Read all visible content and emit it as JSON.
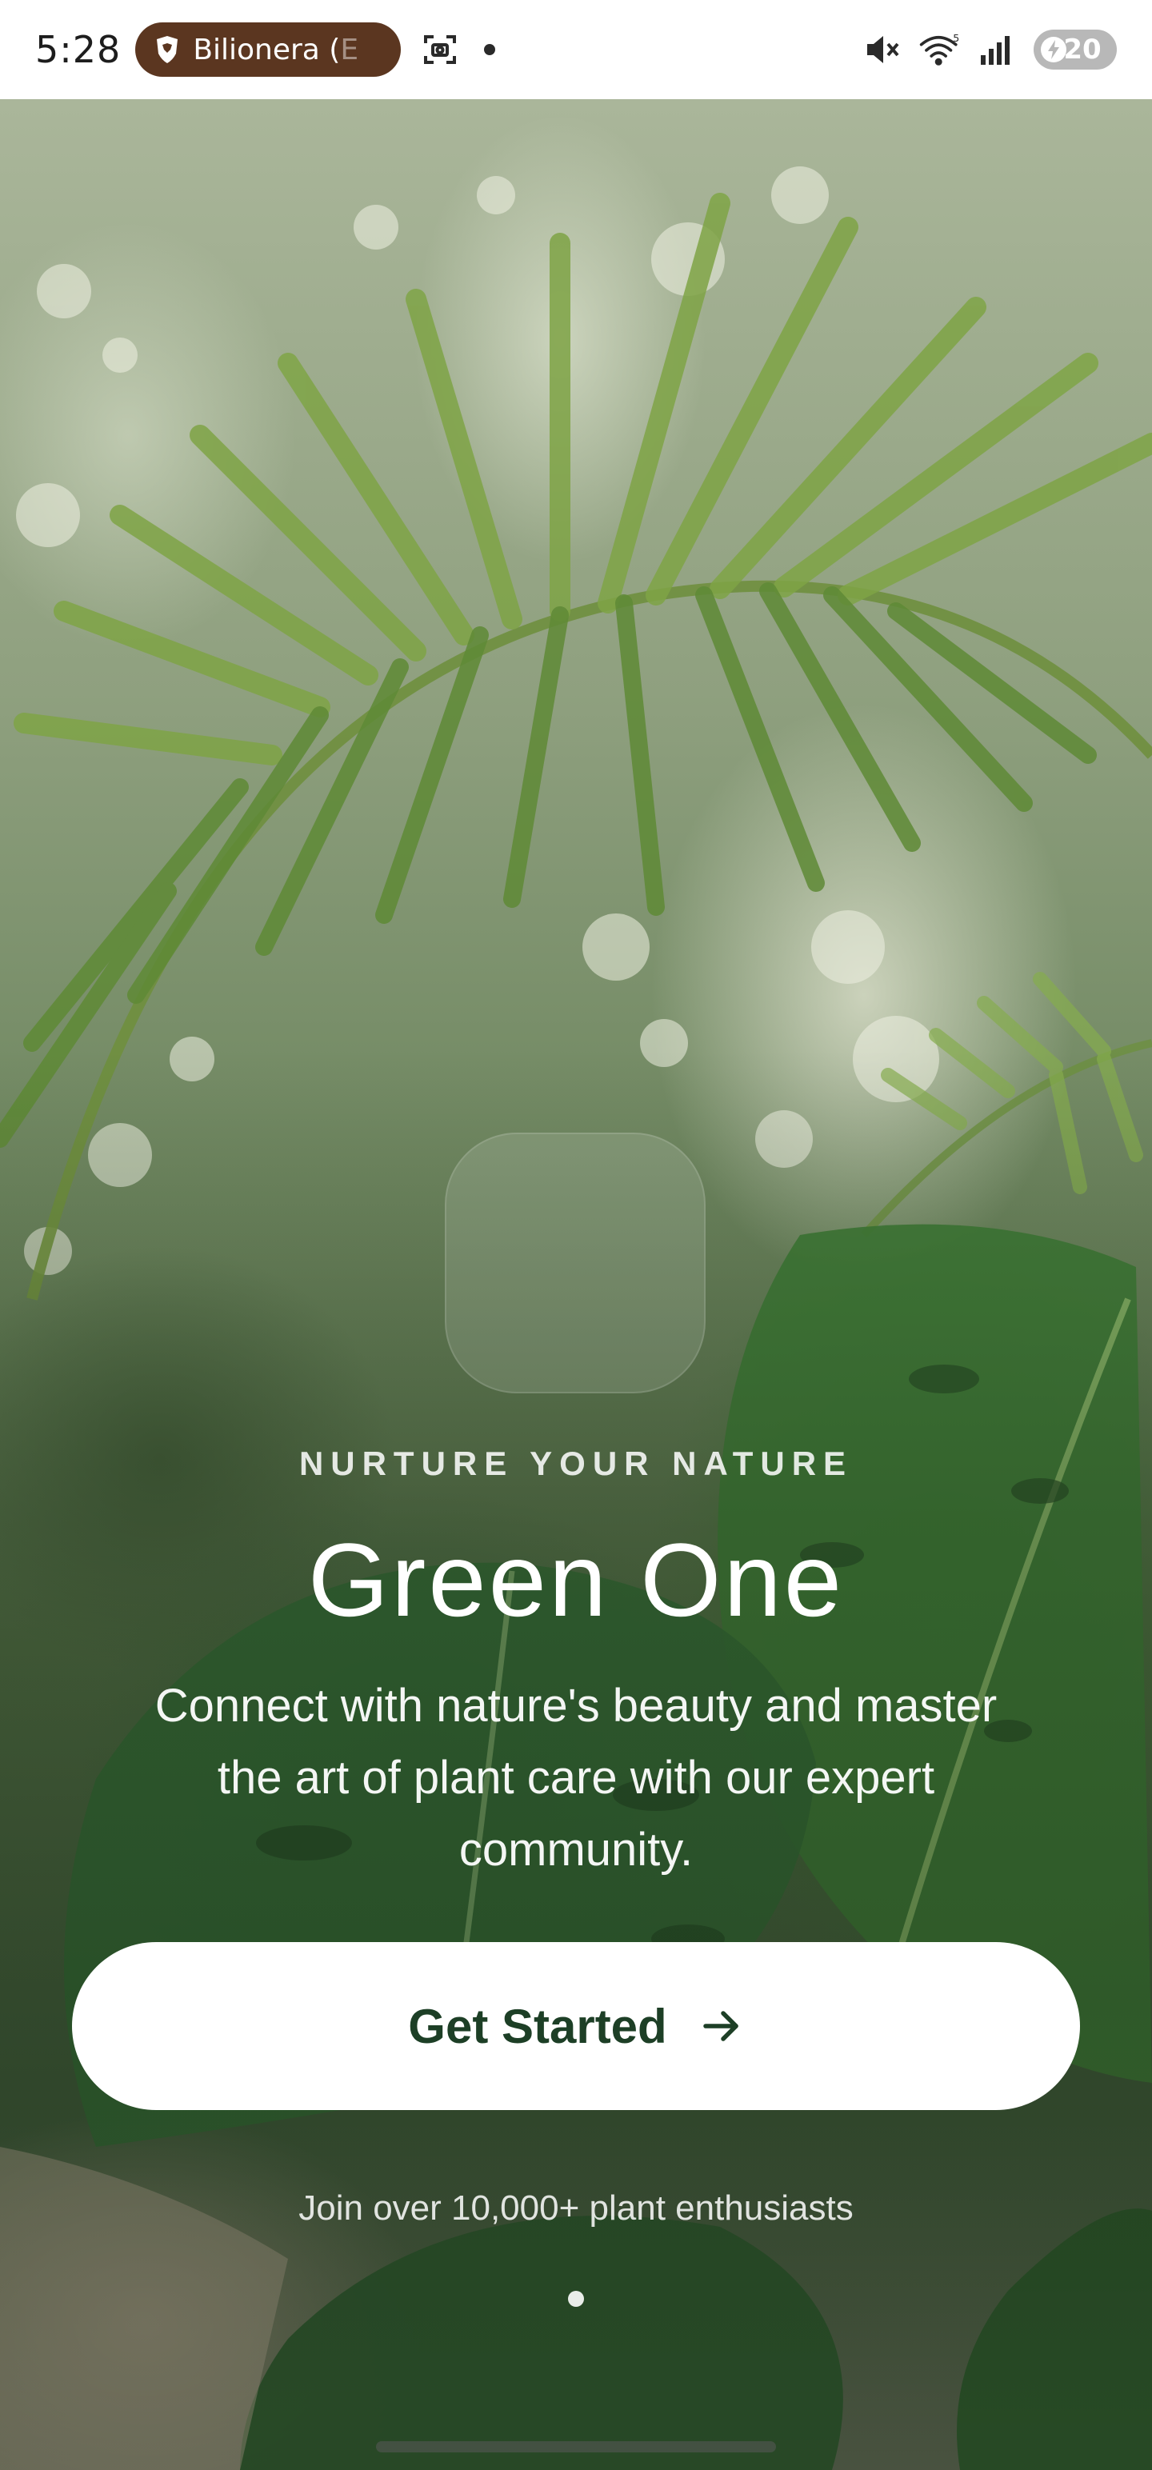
{
  "status_bar": {
    "time": "5:28",
    "app_pill_label": "Bilionera (",
    "app_pill_label_dim": "E",
    "battery_level": "20",
    "network_superscript": "5",
    "icons": [
      "brave-shield-icon",
      "screenshot-icon",
      "mute-icon",
      "wifi-icon",
      "signal-icon",
      "battery-icon"
    ]
  },
  "onboarding": {
    "tagline": "NURTURE YOUR NATURE",
    "title": "Green One",
    "description": "Connect with nature's beauty and master the art of plant care with our expert community.",
    "cta_label": "Get Started",
    "community_text": "Join over 10,000+ plant enthusiasts",
    "pages_total": 1,
    "current_page": 1
  },
  "colors": {
    "accent_dark_green": "#1d3f26",
    "app_pill_brown": "#5b3620",
    "button_background": "#ffffff",
    "text_on_image": "#ffffff"
  }
}
